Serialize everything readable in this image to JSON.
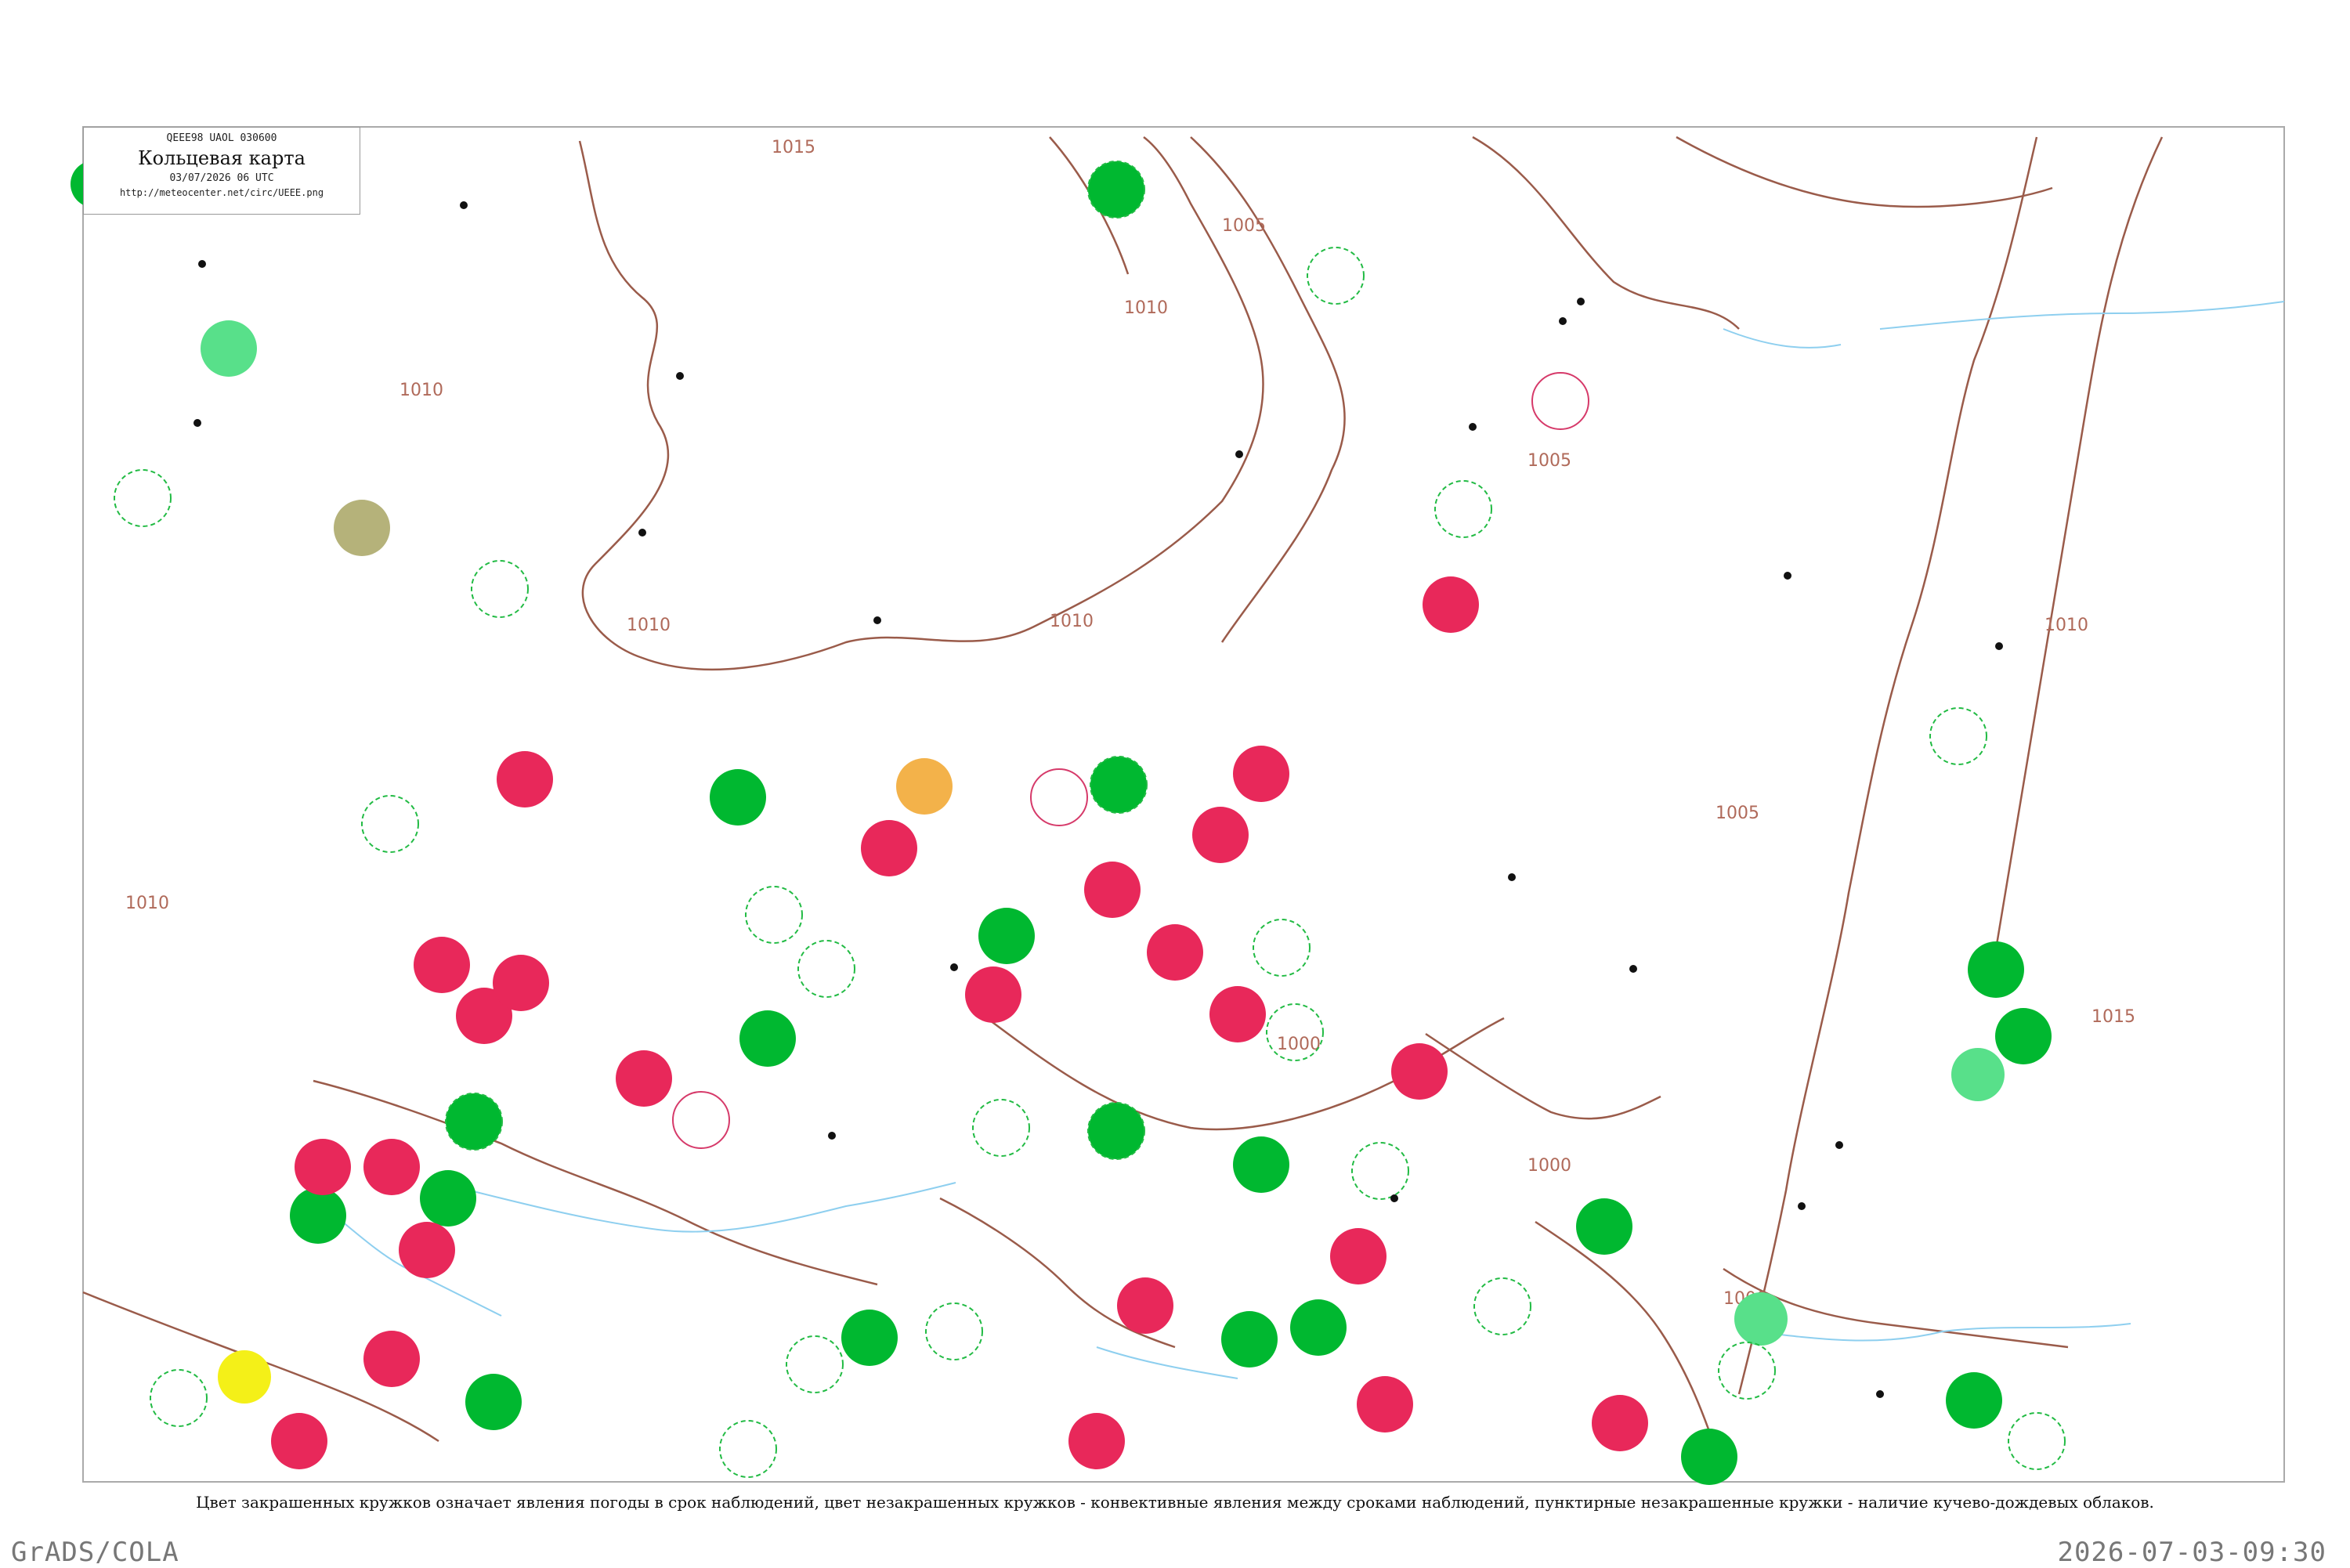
{
  "header": {
    "code": "QEEE98  UAOL  030600",
    "title": "Кольцевая карта",
    "datetime": "03/07/2026 06 UTC",
    "url": "http://meteocenter.net/circ/UEEE.png"
  },
  "isobars": [
    {
      "label": "1015"
    },
    {
      "label": "1010"
    },
    {
      "label": "1005"
    },
    {
      "label": "1000"
    }
  ],
  "legend_caption": "Цвет закрашенных кружков означает явления погоды в срок наблюдений, цвет незакрашенных кружков - конвективные явления между сроками наблюдений, пунктирные незакрашенные кружки - наличие кучево-дождевых облаков.",
  "footer": {
    "left": "GrADS/COLA",
    "right": "2026-07-03-09:30"
  },
  "colors": {
    "rain": "#e8285a",
    "shower": "#00b830",
    "fog": "#f3b24a",
    "haze": "#b5b27a",
    "light": "#58e08a",
    "thunder_ring": "#d63a6a",
    "cb_ring": "#22bb44",
    "coast": "#9a5b4a",
    "river": "#8ecfef"
  }
}
